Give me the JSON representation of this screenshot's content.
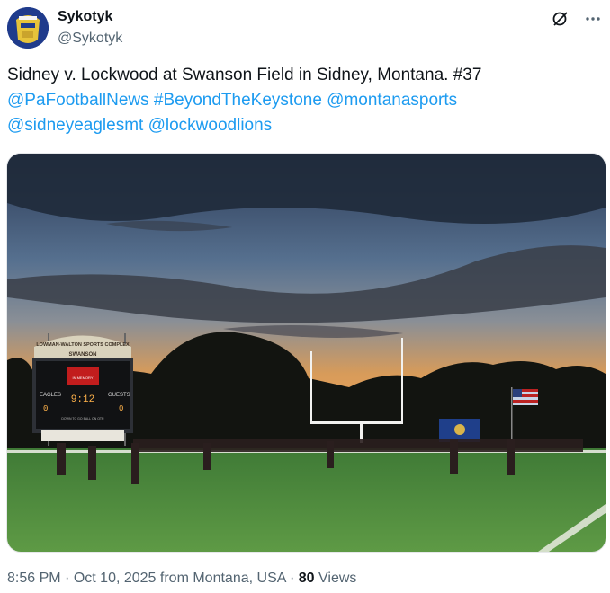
{
  "author": {
    "name": "Sykotyk",
    "handle": "@Sykotyk"
  },
  "icons": {
    "grok": "grok-icon",
    "more": "more-options-icon"
  },
  "tweet": {
    "text_line1": "Sidney v. Lockwood at Swanson Field in Sidney, Montana. #37",
    "mention1": "@PaFootballNews",
    "hashtag1": "#BeyondTheKeystone",
    "mention2": "@montanasports",
    "mention3": "@sidneyeaglesmt",
    "mention4": "@lockwoodlions"
  },
  "scoreboard": {
    "sign_text": "LOWMAN-WALTON SPORTS COMPLEX",
    "field_name": "SWANSON",
    "home_label": "EAGLES",
    "guest_label": "GUESTS",
    "home_score": "0",
    "guest_score": "0",
    "clock": "9:12",
    "row_labels": "DOWN  TO GO  BALL ON  QTR"
  },
  "meta": {
    "time": "8:56 PM",
    "date": "Oct 10, 2025",
    "location": "from Montana, USA",
    "views_count": "80",
    "views_label": "Views"
  },
  "colors": {
    "link": "#1d9bf0",
    "text": "#0f1419",
    "secondary": "#536471"
  }
}
